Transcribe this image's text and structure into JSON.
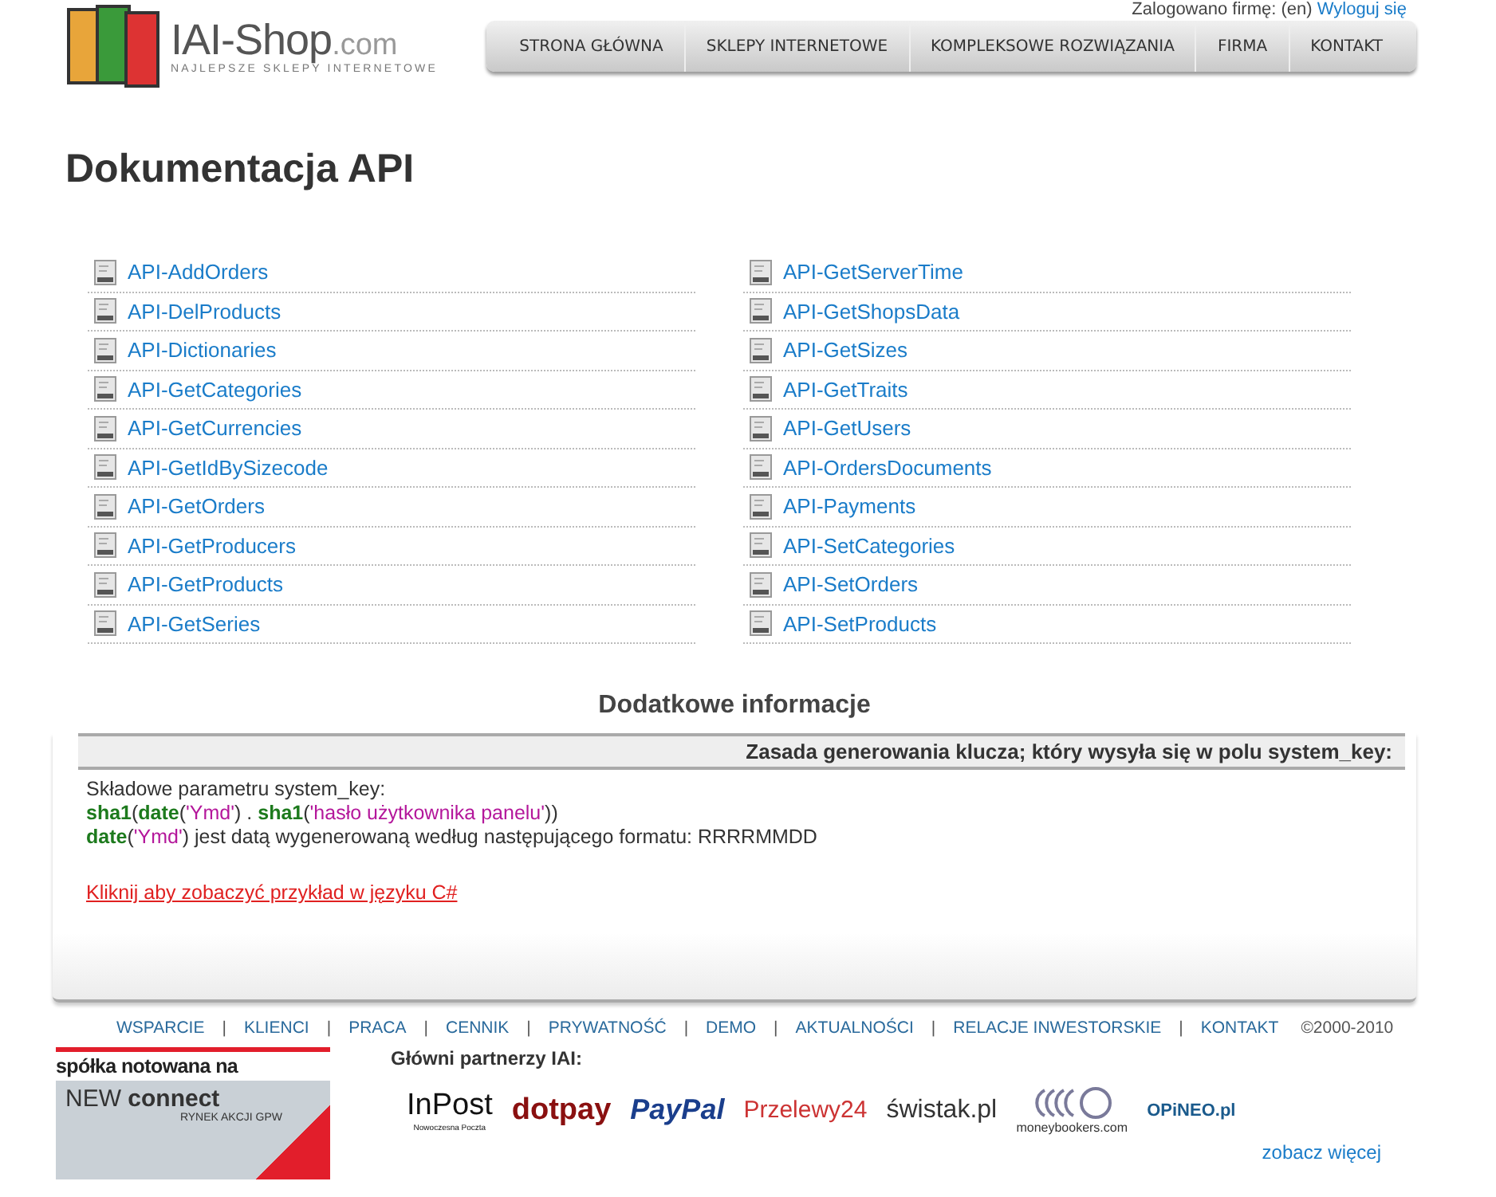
{
  "header": {
    "logo": {
      "name": "IAI-Shop",
      "domain": ".com",
      "tagline": "NAJLEPSZE SKLEPY INTERNETOWE"
    },
    "login": {
      "text": "Zalogowano firmę: (en)",
      "logout": "Wyloguj się"
    },
    "nav": [
      "STRONA GŁÓWNA",
      "SKLEPY INTERNETOWE",
      "KOMPLEKSOWE ROZWIĄZANIA",
      "FIRMA",
      "KONTAKT"
    ]
  },
  "page_title": "Dokumentacja API",
  "api_columns": [
    [
      "API-AddOrders",
      "API-DelProducts",
      "API-Dictionaries",
      "API-GetCategories",
      "API-GetCurrencies",
      "API-GetIdBySizecode",
      "API-GetOrders",
      "API-GetProducers",
      "API-GetProducts",
      "API-GetSeries"
    ],
    [
      "API-GetServerTime",
      "API-GetShopsData",
      "API-GetSizes",
      "API-GetTraits",
      "API-GetUsers",
      "API-OrdersDocuments",
      "API-Payments",
      "API-SetCategories",
      "API-SetOrders",
      "API-SetProducts"
    ]
  ],
  "info": {
    "title": "Dodatkowe informacje",
    "table_header": "Zasada generowania klucza; który wysyła się w polu system_key:",
    "lines": [
      [
        {
          "kind": "plain",
          "text": "Składowe parametru system_key:"
        }
      ],
      [
        {
          "kind": "func",
          "text": "sha1"
        },
        {
          "kind": "plain",
          "text": "("
        },
        {
          "kind": "func",
          "text": "date"
        },
        {
          "kind": "plain",
          "text": "("
        },
        {
          "kind": "str",
          "text": "'Ymd'"
        },
        {
          "kind": "plain",
          "text": ") . "
        },
        {
          "kind": "func",
          "text": "sha1"
        },
        {
          "kind": "plain",
          "text": "("
        },
        {
          "kind": "str",
          "text": "'hasło użytkownika panelu'"
        },
        {
          "kind": "plain",
          "text": "))"
        }
      ],
      [
        {
          "kind": "func",
          "text": "date"
        },
        {
          "kind": "plain",
          "text": "("
        },
        {
          "kind": "str",
          "text": "'Ymd'"
        },
        {
          "kind": "plain",
          "text": ") jest datą wygenerowaną według następującego formatu: RRRRMMDD"
        }
      ]
    ],
    "example_link": "Kliknij aby zobaczyć przykład w języku C#"
  },
  "footer": {
    "links": [
      {
        "kind": "link",
        "text": "WSPARCIE"
      },
      {
        "kind": "sep",
        "text": "|"
      },
      {
        "kind": "link",
        "text": "KLIENCI"
      },
      {
        "kind": "sep",
        "text": "|"
      },
      {
        "kind": "link",
        "text": "PRACA"
      },
      {
        "kind": "sep",
        "text": "|"
      },
      {
        "kind": "link",
        "text": "CENNIK"
      },
      {
        "kind": "sep",
        "text": "|"
      },
      {
        "kind": "link",
        "text": "PRYWATNOŚĆ"
      },
      {
        "kind": "sep",
        "text": "|"
      },
      {
        "kind": "link",
        "text": "DEMO"
      },
      {
        "kind": "sep",
        "text": "|"
      },
      {
        "kind": "link",
        "text": "AKTUALNOŚCI"
      },
      {
        "kind": "sep",
        "text": "|"
      },
      {
        "kind": "link",
        "text": "RELACJE INWESTORSKIE"
      },
      {
        "kind": "sep",
        "text": "|"
      },
      {
        "kind": "link",
        "text": "KONTAKT"
      }
    ],
    "copyright": "©2000-2010",
    "newconnect": {
      "top": "spółka notowana na",
      "brand_new": "NEW",
      "brand_connect": "connect",
      "sub": "RYNEK AKCJI GPW"
    },
    "partners_title": "Główni partnerzy IAI:",
    "partners": [
      {
        "kind": "inpost",
        "text": "InPost",
        "sub": "Nowoczesna Poczta"
      },
      {
        "kind": "dotpay",
        "text": "dotpay"
      },
      {
        "kind": "paypal",
        "text": "PayPal"
      },
      {
        "kind": "przelewy",
        "text": "Przelewy24"
      },
      {
        "kind": "swistak",
        "text": "świstak.pl"
      },
      {
        "kind": "moneybookers",
        "text": "moneybookers.com"
      },
      {
        "kind": "opineo",
        "text": "OPiNEO.pl"
      }
    ],
    "more": "zobacz więcej"
  }
}
